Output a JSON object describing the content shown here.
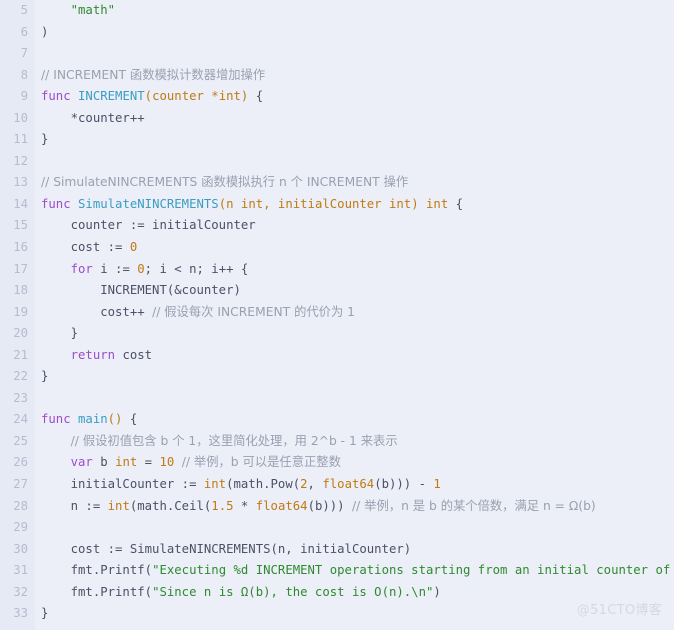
{
  "editor": {
    "language": "go",
    "first_line_number": 5,
    "last_line_number": 33,
    "background_color": "#eceff8",
    "gutter_color": "#e6eaf5",
    "line_number_color": "#b6bcd0",
    "default_text_color": "#4d5066",
    "keyword_color": "#9b4dca",
    "function_color": "#3b9cc4",
    "type_color": "#c07a12",
    "number_color": "#c07a12",
    "string_color": "#2e8b2e",
    "comment_color": "#9aa0b0"
  },
  "watermark": {
    "text": "@51CTO博客"
  },
  "lines": [
    {
      "n": "5",
      "tokens": [
        {
          "t": "    ",
          "c": "pl"
        },
        {
          "t": "\"math\"",
          "c": "str"
        }
      ]
    },
    {
      "n": "6",
      "tokens": [
        {
          "t": ")",
          "c": "pl"
        }
      ]
    },
    {
      "n": "7",
      "tokens": []
    },
    {
      "n": "8",
      "tokens": [
        {
          "t": "// INCREMENT 函数模拟计数器增加操作",
          "c": "cmt"
        }
      ]
    },
    {
      "n": "9",
      "tokens": [
        {
          "t": "func",
          "c": "kw"
        },
        {
          "t": " ",
          "c": "pl"
        },
        {
          "t": "INCREMENT",
          "c": "fn"
        },
        {
          "t": "(",
          "c": "pun"
        },
        {
          "t": "counter *int",
          "c": "typ"
        },
        {
          "t": ")",
          "c": "pun"
        },
        {
          "t": " {",
          "c": "pl"
        }
      ]
    },
    {
      "n": "10",
      "tokens": [
        {
          "t": "    *counter++",
          "c": "pl"
        }
      ]
    },
    {
      "n": "11",
      "tokens": [
        {
          "t": "}",
          "c": "pl"
        }
      ]
    },
    {
      "n": "12",
      "tokens": []
    },
    {
      "n": "13",
      "tokens": [
        {
          "t": "// SimulateNINCREMENTS 函数模拟执行 n 个 INCREMENT 操作",
          "c": "cmt"
        }
      ]
    },
    {
      "n": "14",
      "tokens": [
        {
          "t": "func",
          "c": "kw"
        },
        {
          "t": " ",
          "c": "pl"
        },
        {
          "t": "SimulateNINCREMENTS",
          "c": "fn"
        },
        {
          "t": "(",
          "c": "pun"
        },
        {
          "t": "n int, initialCounter int",
          "c": "typ"
        },
        {
          "t": ")",
          "c": "pun"
        },
        {
          "t": " ",
          "c": "pl"
        },
        {
          "t": "int",
          "c": "typ"
        },
        {
          "t": " {",
          "c": "pl"
        }
      ]
    },
    {
      "n": "15",
      "tokens": [
        {
          "t": "    counter := initialCounter",
          "c": "pl"
        }
      ]
    },
    {
      "n": "16",
      "tokens": [
        {
          "t": "    cost := ",
          "c": "pl"
        },
        {
          "t": "0",
          "c": "num"
        }
      ]
    },
    {
      "n": "17",
      "tokens": [
        {
          "t": "    ",
          "c": "pl"
        },
        {
          "t": "for",
          "c": "kw"
        },
        {
          "t": " i := ",
          "c": "pl"
        },
        {
          "t": "0",
          "c": "num"
        },
        {
          "t": "; i < n; i++ {",
          "c": "pl"
        }
      ]
    },
    {
      "n": "18",
      "tokens": [
        {
          "t": "        INCREMENT(&counter)",
          "c": "pl"
        }
      ]
    },
    {
      "n": "19",
      "tokens": [
        {
          "t": "        cost++ ",
          "c": "pl"
        },
        {
          "t": "// 假设每次 INCREMENT 的代价为 1",
          "c": "cmt"
        }
      ]
    },
    {
      "n": "20",
      "tokens": [
        {
          "t": "    }",
          "c": "pl"
        }
      ]
    },
    {
      "n": "21",
      "tokens": [
        {
          "t": "    ",
          "c": "pl"
        },
        {
          "t": "return",
          "c": "kw"
        },
        {
          "t": " cost",
          "c": "pl"
        }
      ]
    },
    {
      "n": "22",
      "tokens": [
        {
          "t": "}",
          "c": "pl"
        }
      ]
    },
    {
      "n": "23",
      "tokens": []
    },
    {
      "n": "24",
      "tokens": [
        {
          "t": "func",
          "c": "kw"
        },
        {
          "t": " ",
          "c": "pl"
        },
        {
          "t": "main",
          "c": "fn"
        },
        {
          "t": "()",
          "c": "pun"
        },
        {
          "t": " {",
          "c": "pl"
        }
      ]
    },
    {
      "n": "25",
      "tokens": [
        {
          "t": "    ",
          "c": "pl"
        },
        {
          "t": "// 假设初值包含 b 个 1，这里简化处理，用 2^b - 1 来表示",
          "c": "cmt"
        }
      ]
    },
    {
      "n": "26",
      "tokens": [
        {
          "t": "    ",
          "c": "pl"
        },
        {
          "t": "var",
          "c": "kw"
        },
        {
          "t": " b ",
          "c": "pl"
        },
        {
          "t": "int",
          "c": "typ"
        },
        {
          "t": " = ",
          "c": "pl"
        },
        {
          "t": "10",
          "c": "num"
        },
        {
          "t": " ",
          "c": "pl"
        },
        {
          "t": "// 举例，b 可以是任意正整数",
          "c": "cmt"
        }
      ]
    },
    {
      "n": "27",
      "tokens": [
        {
          "t": "    initialCounter := ",
          "c": "pl"
        },
        {
          "t": "int",
          "c": "typ"
        },
        {
          "t": "(math.Pow(",
          "c": "pl"
        },
        {
          "t": "2",
          "c": "num"
        },
        {
          "t": ", ",
          "c": "pl"
        },
        {
          "t": "float64",
          "c": "typ"
        },
        {
          "t": "(b))) - ",
          "c": "pl"
        },
        {
          "t": "1",
          "c": "num"
        }
      ]
    },
    {
      "n": "28",
      "tokens": [
        {
          "t": "    n := ",
          "c": "pl"
        },
        {
          "t": "int",
          "c": "typ"
        },
        {
          "t": "(math.Ceil(",
          "c": "pl"
        },
        {
          "t": "1.5",
          "c": "num"
        },
        {
          "t": " * ",
          "c": "pl"
        },
        {
          "t": "float64",
          "c": "typ"
        },
        {
          "t": "(b))) ",
          "c": "pl"
        },
        {
          "t": "// 举例，n 是 b 的某个倍数，满足 n = Ω(b)",
          "c": "cmt"
        }
      ]
    },
    {
      "n": "29",
      "tokens": []
    },
    {
      "n": "30",
      "tokens": [
        {
          "t": "    cost := SimulateNINCREMENTS(n, initialCounter)",
          "c": "pl"
        }
      ]
    },
    {
      "n": "31",
      "tokens": [
        {
          "t": "    fmt.Printf(",
          "c": "pl"
        },
        {
          "t": "\"Executing %d INCREMENT operations starting from an initial counter of",
          "c": "str"
        }
      ]
    },
    {
      "n": "32",
      "tokens": [
        {
          "t": "    fmt.Printf(",
          "c": "pl"
        },
        {
          "t": "\"Since n is Ω(b), the cost is O(n).\\n\"",
          "c": "str"
        },
        {
          "t": ")",
          "c": "pl"
        }
      ]
    },
    {
      "n": "33",
      "tokens": [
        {
          "t": "}",
          "c": "pl"
        }
      ]
    }
  ]
}
